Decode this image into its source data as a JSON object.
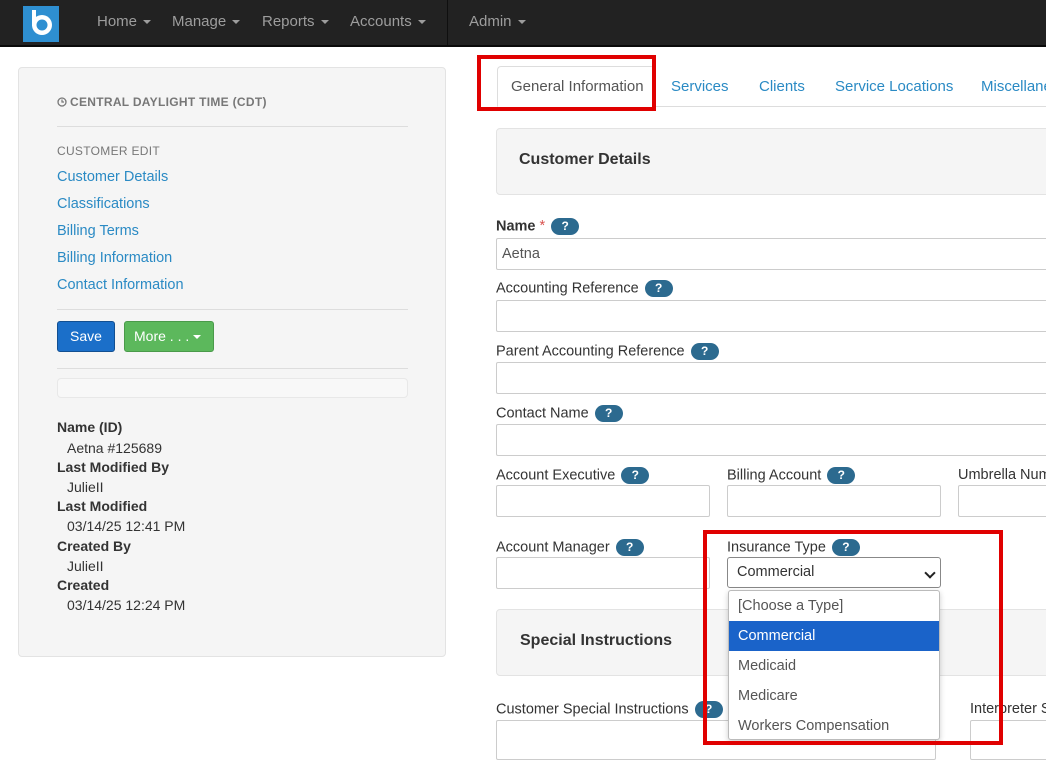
{
  "navbar": {
    "logo_letter": "b",
    "items": [
      {
        "label": "Home"
      },
      {
        "label": "Manage"
      },
      {
        "label": "Reports"
      },
      {
        "label": "Accounts"
      },
      {
        "label": "Admin"
      }
    ]
  },
  "sidebar": {
    "timezone": "CENTRAL DAYLIGHT TIME (CDT)",
    "section_header": "CUSTOMER EDIT",
    "links": [
      "Customer Details",
      "Classifications",
      "Billing Terms",
      "Billing Information",
      "Contact Information"
    ],
    "save_label": "Save",
    "more_label": "More . . .",
    "meta": {
      "name_id_label": "Name (ID)",
      "name_id_value": "Aetna #125689",
      "last_modified_by_label": "Last Modified By",
      "last_modified_by_value": "JulieII",
      "last_modified_label": "Last Modified",
      "last_modified_value": "03/14/25 12:41 PM",
      "created_by_label": "Created By",
      "created_by_value": "JulieII",
      "created_label": "Created",
      "created_value": "03/14/25 12:24 PM"
    }
  },
  "tabs": [
    "General Information",
    "Services",
    "Clients",
    "Service Locations",
    "Miscellane"
  ],
  "customer_details": {
    "title": "Customer Details",
    "help_symbol": "?",
    "required_mark": "*",
    "fields": {
      "name_label": "Name",
      "name_value": "Aetna",
      "accounting_reference_label": "Accounting Reference",
      "parent_accounting_reference_label": "Parent Accounting Reference",
      "contact_name_label": "Contact Name",
      "account_executive_label": "Account Executive",
      "billing_account_label": "Billing Account",
      "umbrella_label": "Umbrella Num",
      "account_manager_label": "Account Manager",
      "insurance_type_label": "Insurance Type",
      "insurance_type_value": "Commercial"
    }
  },
  "insurance_options": [
    "[Choose a Type]",
    "Commercial",
    "Medicaid",
    "Medicare",
    "Workers Compensation"
  ],
  "special_instructions": {
    "title": "Special Instructions",
    "customer_label": "Customer Special Instructions",
    "interpreter_label": "Interpreter S"
  },
  "colors": {
    "link": "#2a8ac4",
    "annotation_red": "#e00000",
    "selected_option": "#1a63c9"
  }
}
